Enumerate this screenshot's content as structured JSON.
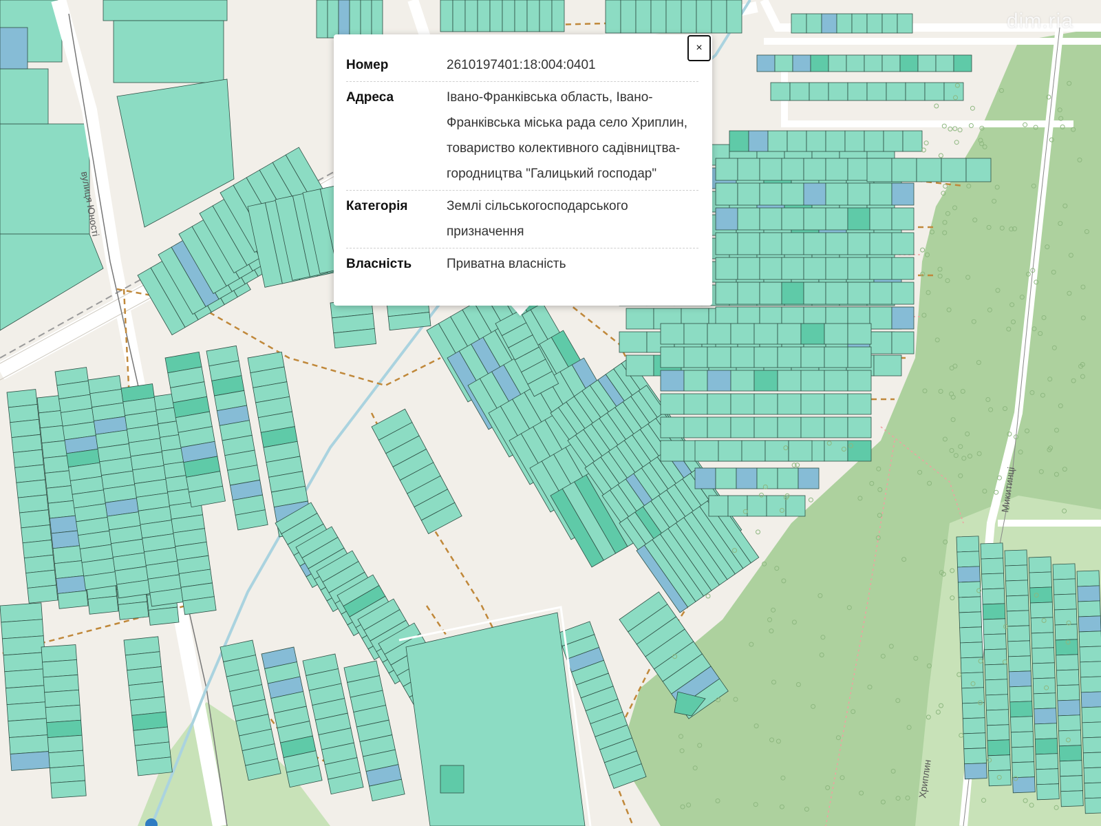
{
  "watermark": "dim.ria",
  "streets": {
    "yunosti": "вулиця Юності",
    "mykytyntsi": "Микитинці",
    "khryplyn": "Хриплин"
  },
  "popup": {
    "close_label": "×",
    "rows": [
      {
        "key": "Номер",
        "value": "2610197401:18:004:0401"
      },
      {
        "key": "Адреса",
        "value": "Івано-Франківська область, Івано-Франківська міська рада село Хриплин, товариство колективного садівництва-городництва \"Галицький господар\""
      },
      {
        "key": "Категорія",
        "value": "Землі сільськогосподарського призначення"
      },
      {
        "key": "Власність",
        "value": "Приватна власність"
      }
    ]
  },
  "colors": {
    "base": "#f2efe9",
    "parcel": "#8cdcc3",
    "parcel_blue": "#86bcd6",
    "forest": "#add19e",
    "road": "#ffffff",
    "track": "#c0883a",
    "water": "#aad3df"
  }
}
